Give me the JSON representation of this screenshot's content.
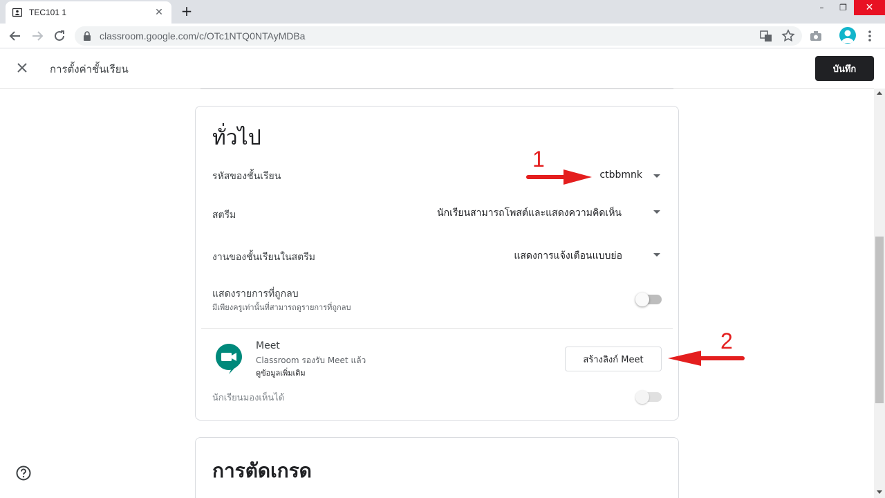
{
  "browser": {
    "tab_title": "TEC101 1",
    "tab_close": "✕",
    "new_tab": "+",
    "url": "classroom.google.com/c/OTc1NTQ0NTAyMDBa",
    "window_controls": {
      "minimize": "–",
      "restore": "❐",
      "close": "✕"
    }
  },
  "header": {
    "title": "การตั้งค่าชั้นเรียน",
    "save_label": "บันทึก"
  },
  "general": {
    "title": "ทั่วไป",
    "class_code": {
      "label": "รหัสของชั้นเรียน",
      "value": "ctbbmnk"
    },
    "stream": {
      "label": "สตรีม",
      "value": "นักเรียนสามารถโพสต์และแสดงความคิดเห็น"
    },
    "classwork_on_stream": {
      "label": "งานของชั้นเรียนในสตรีม",
      "value": "แสดงการแจ้งเตือนแบบย่อ"
    },
    "show_deleted": {
      "label": "แสดงรายการที่ถูกลบ",
      "sub": "มีเพียงครูเท่านั้นที่สามารถดูรายการที่ถูกลบ",
      "enabled": false
    },
    "meet": {
      "title": "Meet",
      "sub": "Classroom รองรับ Meet แล้ว",
      "learn_more": "ดูข้อมูลเพิ่มเติม",
      "button": "สร้างลิงก์ Meet",
      "visible_label": "นักเรียนมองเห็นได้",
      "visible_enabled": false
    }
  },
  "grading": {
    "title": "การตัดเกรด"
  },
  "annotations": {
    "first": "1",
    "second": "2",
    "color": "#e41e1e"
  },
  "colors": {
    "save_button": "#202124",
    "meet_green": "#00897b"
  }
}
